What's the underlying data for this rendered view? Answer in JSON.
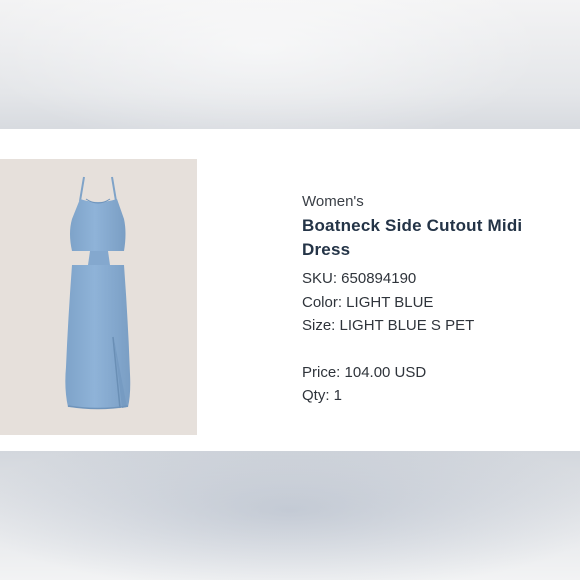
{
  "product": {
    "category": "Women's",
    "title": "Boatneck Side Cutout Midi Dress",
    "sku_label": "SKU: 650894190",
    "color_label": "Color: LIGHT BLUE",
    "size_label": "Size: LIGHT BLUE S PET",
    "price_label": "Price: 104.00 USD",
    "qty_label": "Qty: 1"
  },
  "image": {
    "subject": "light blue midi dress with side cutouts",
    "dress_color": "#8aaed3",
    "background_color": "#e6e0db"
  }
}
